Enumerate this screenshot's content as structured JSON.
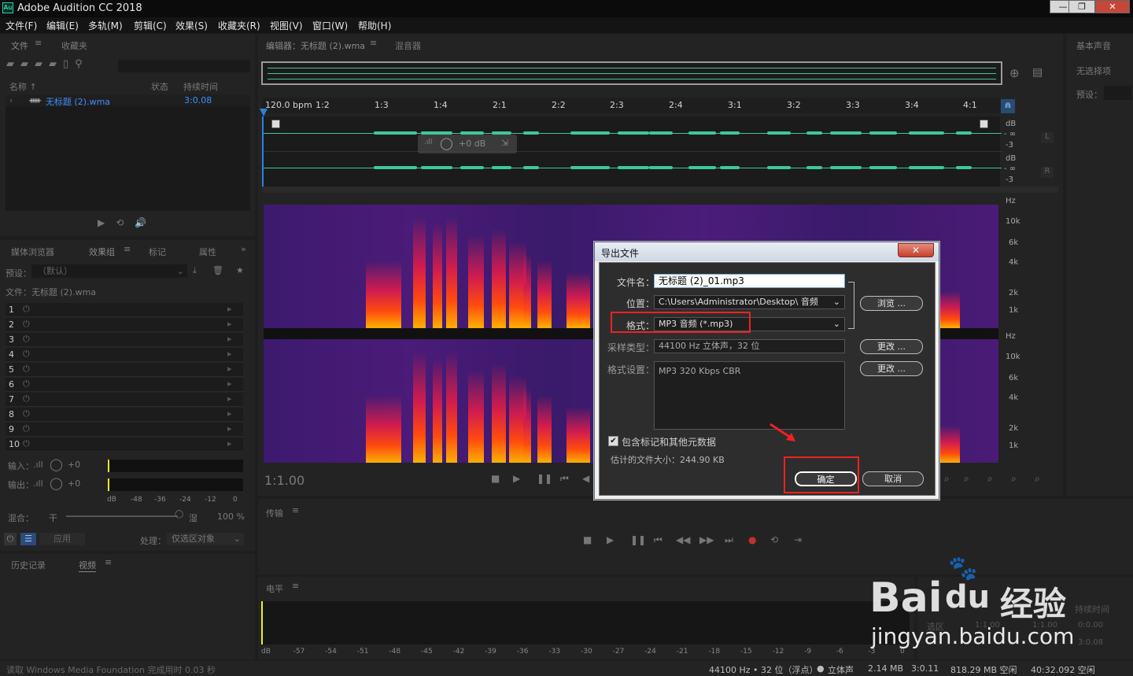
{
  "app": {
    "title": "Adobe Audition CC 2018",
    "logo": "Au"
  },
  "window_controls": {
    "minimize": "—",
    "maximize": "❐",
    "close": "✕"
  },
  "menu": [
    "文件(F)",
    "编辑(E)",
    "多轨(M)",
    "剪辑(C)",
    "效果(S)",
    "收藏夹(R)",
    "视图(V)",
    "窗口(W)",
    "帮助(H)"
  ],
  "files_panel": {
    "tabs": [
      "文件",
      "收藏夹"
    ],
    "cols": {
      "name": "名称 ↑",
      "status": "状态",
      "duration": "持续时间"
    },
    "file": {
      "name": "无标题 (2).wma",
      "duration": "3:0.08"
    }
  },
  "effects_panel": {
    "tabs": [
      "媒体浏览器",
      "效果组",
      "标记",
      "属性"
    ],
    "preset_label": "预设：",
    "preset_value": "（默认）",
    "file_label": "文件：无标题 (2).wma",
    "rows": [
      "1",
      "2",
      "3",
      "4",
      "5",
      "6",
      "7",
      "8",
      "9",
      "10"
    ],
    "input_label": "输入：",
    "output_label": "输出：",
    "input_val": "+0",
    "output_val": "+0",
    "db_scale": [
      "dB",
      "-48",
      "-36",
      "-24",
      "-12",
      "0"
    ],
    "mix_label": "混合：",
    "mix_dry": "干",
    "mix_wet": "湿",
    "mix_val": "100 %",
    "apply_label": "应用",
    "process_label": "处理：",
    "process_value": "仅选区对象"
  },
  "history_panel": {
    "tabs": [
      "历史记录",
      "视频"
    ]
  },
  "editor": {
    "tabs": [
      "编辑器：无标题 (2).wma",
      "混音器"
    ],
    "ruler": [
      "120.0 bpm",
      "1:2",
      "1:3",
      "1:4",
      "2:1",
      "2:2",
      "2:3",
      "2:4",
      "3:1",
      "3:2",
      "3:3",
      "3:4",
      "4:1"
    ],
    "db_labels": [
      "dB",
      "- ∞",
      "-3",
      "dB",
      "- ∞",
      "-3"
    ],
    "channels": [
      "L",
      "R"
    ],
    "hud": "+0 dB",
    "hz_top": [
      "Hz",
      "10k",
      "6k",
      "4k",
      "2k",
      "1k"
    ],
    "hz_bottom": [
      "Hz",
      "10k",
      "6k",
      "4k",
      "2k",
      "1k"
    ],
    "timecode": "1:1.00"
  },
  "right_panel": {
    "title": "基本声音",
    "no_selection": "无选择项",
    "preset_label": "预设："
  },
  "transport_panel": {
    "title": "传输"
  },
  "level_panel": {
    "title": "电平",
    "scale": [
      "dB",
      "-57",
      "-54",
      "-51",
      "-48",
      "-45",
      "-42",
      "-39",
      "-36",
      "-33",
      "-30",
      "-27",
      "-24",
      "-21",
      "-18",
      "-15",
      "-12",
      "-9",
      "-6",
      "-3",
      "0"
    ]
  },
  "selection_panel": {
    "duration_label": "持续时间",
    "selection_label": "选区",
    "values": [
      "1:1.00",
      "1:1.00",
      "0:0.00",
      "3:0.08"
    ]
  },
  "dialog": {
    "title": "导出文件",
    "filename_label": "文件名：",
    "filename": "无标题 (2)_01.mp3",
    "location_label": "位置：",
    "location": "C:\\Users\\Administrator\\Desktop\\ 音频",
    "browse": "浏览 ...",
    "format_label": "格式：",
    "format": "MP3 音频 (*.mp3)",
    "sample_label": "采样类型：",
    "sample": "44100 Hz 立体声，32 位",
    "change1": "更改 ...",
    "format_settings_label": "格式设置：",
    "format_settings": "MP3 320 Kbps CBR",
    "change2": "更改 ...",
    "include_markers": "包含标记和其他元数据",
    "size_estimate": "估计的文件大小：244.90 KB",
    "ok": "确定",
    "cancel": "取消"
  },
  "status": {
    "left": "读取 Windows Media Foundation 完成用时 0.03 秒",
    "sample_rate": "44100 Hz • 32 位（浮点）",
    "channels": "立体声",
    "size": "2.14 MB",
    "duration": "3:0.11",
    "free": "818.29 MB 空闲",
    "time_free": "40:32.092 空闲"
  },
  "watermark": {
    "brand": "Bai",
    "brand2": "du",
    "cn": "经验",
    "url": "jingyan.baidu.com"
  },
  "colors": {
    "accent": "#2f7fe0",
    "wave": "#3fc79a",
    "highlight": "#e22222"
  }
}
